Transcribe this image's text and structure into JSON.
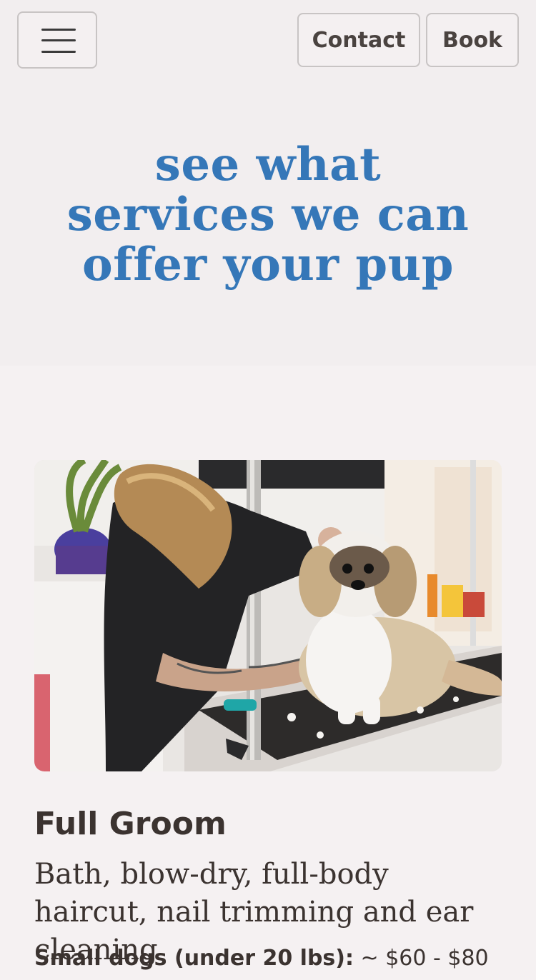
{
  "nav": {
    "menu_icon": "hamburger-menu-icon",
    "contact_label": "Contact",
    "book_label": "Book"
  },
  "hero": {
    "title": "see what services we can offer your pup"
  },
  "service": {
    "image_alt": "groomer trimming a shih tzu on a grooming table",
    "title": "Full Groom",
    "description": "Bath, blow-dry, full-body haircut, nail trimming and ear cleaning",
    "price_label": "Small dogs (under 20 lbs):",
    "price_value": "~ $60 - $80"
  },
  "colors": {
    "accent": "#3577b8",
    "background": "#f5f1f2",
    "text": "#3b3330"
  }
}
